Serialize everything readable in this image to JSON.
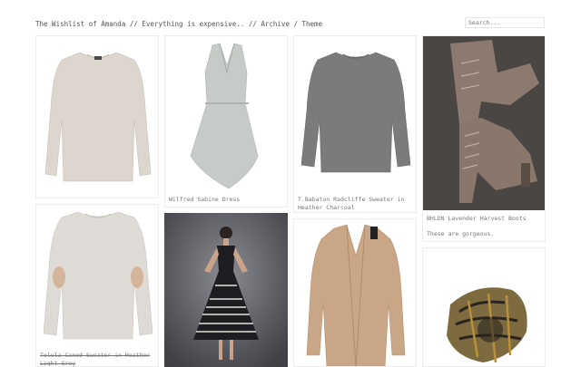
{
  "header": {
    "blog_title": "The Wishlist of Amanda",
    "separator": "//",
    "tagline": "Everything is expensive..",
    "nav_archive": "Archive",
    "nav_slash": "/",
    "nav_theme": "Theme"
  },
  "search": {
    "placeholder": "Search..."
  },
  "posts": [
    {
      "caption": ""
    },
    {
      "caption": "Wilfred Sabine Dress"
    },
    {
      "caption": "T.Babaton Radcliffe Sweater in Heather Charcoal"
    },
    {
      "caption": "BHLDN Lavender Harvest Boots",
      "note": "These are gorgeous."
    },
    {
      "caption": "Tolula Caned Sweater in Heather Light Grey"
    },
    {
      "caption": ""
    },
    {
      "caption": ""
    },
    {
      "caption": ""
    }
  ]
}
